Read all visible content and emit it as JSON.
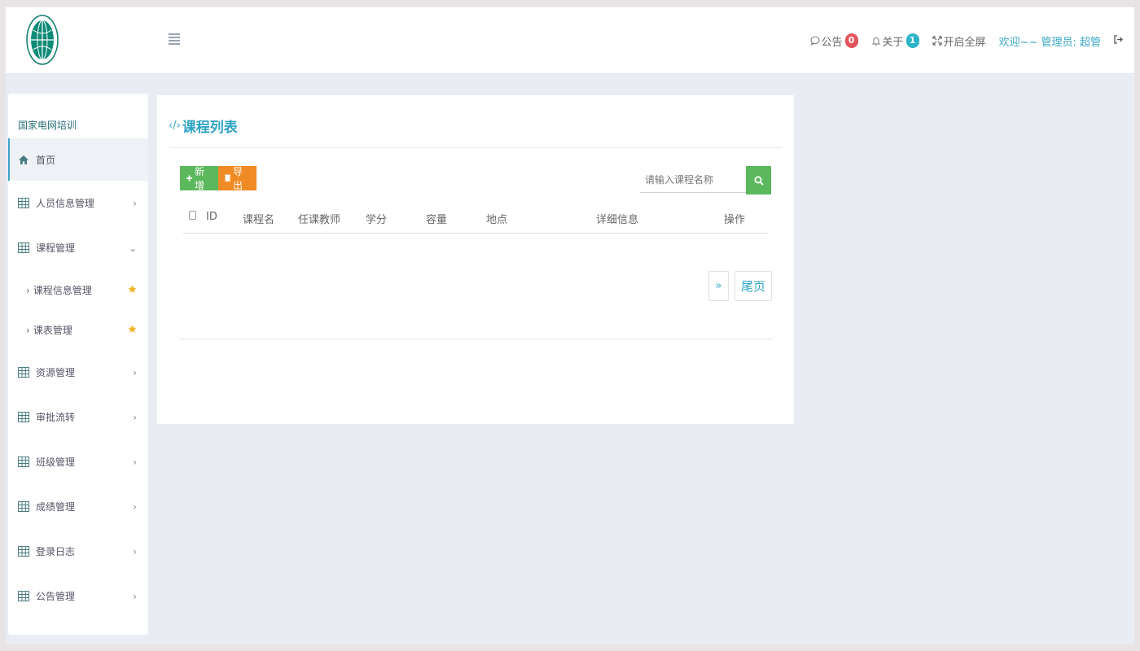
{
  "header": {
    "notice_label": "公告",
    "notice_count": "0",
    "about_label": "关于",
    "about_count": "1",
    "fullscreen_label": "开启全屏",
    "welcome_text": "欢迎~~ 管理员: 超管"
  },
  "sidebar": {
    "title": "国家电网培训",
    "items": [
      {
        "label": "首页",
        "icon": "home-icon",
        "active": true
      },
      {
        "label": "人员信息管理",
        "icon": "grid-icon",
        "arrow": "›"
      },
      {
        "label": "课程管理",
        "icon": "grid-icon",
        "arrow": "⌄"
      },
      {
        "label": "课程信息管理",
        "sub": true,
        "starred": true
      },
      {
        "label": "课表管理",
        "sub": true,
        "starred": true
      },
      {
        "label": "资源管理",
        "icon": "grid-icon",
        "arrow": "›"
      },
      {
        "label": "审批流转",
        "icon": "grid-icon",
        "arrow": "›"
      },
      {
        "label": "班级管理",
        "icon": "grid-icon",
        "arrow": "›"
      },
      {
        "label": "成绩管理",
        "icon": "grid-icon",
        "arrow": "›"
      },
      {
        "label": "登录日志",
        "icon": "grid-icon",
        "arrow": "›"
      },
      {
        "label": "公告管理",
        "icon": "grid-icon",
        "arrow": "›"
      }
    ]
  },
  "main": {
    "title": "课程列表",
    "add_label": "新增",
    "export_label": "导出",
    "search_placeholder": "请输入课程名称",
    "columns": [
      "ID",
      "课程名",
      "任课教师",
      "学分",
      "容量",
      "地点",
      "详细信息",
      "操作"
    ],
    "pager_next": "»",
    "pager_last": "尾页"
  },
  "colors": {
    "accent": "#2fa4c4",
    "green": "#5cb85c",
    "orange": "#f08a24",
    "badge_red": "#e5535a",
    "badge_teal": "#2cb3c8"
  }
}
